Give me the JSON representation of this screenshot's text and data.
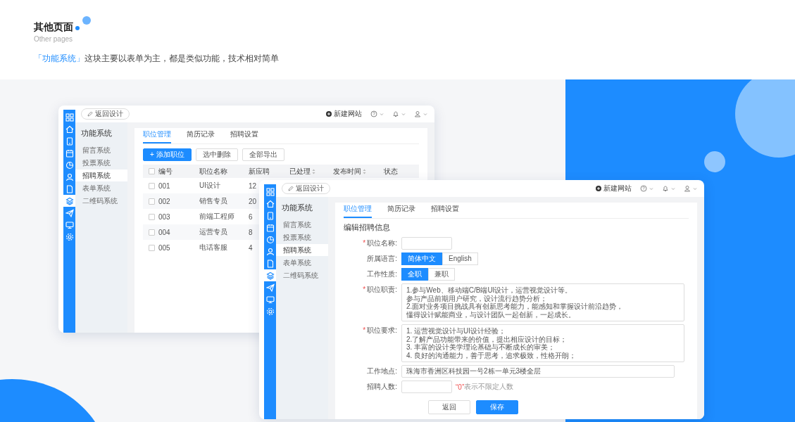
{
  "header": {
    "title": "其他页面",
    "subtitle": "Other pages",
    "description_highlight": "「功能系统」",
    "description": "这块主要以表单为主，都是类似功能，技术相对简单"
  },
  "windows": [
    {
      "kind": "list",
      "back_button": "返回设计",
      "new_site": "新建网站",
      "icon_bar": [
        {
          "selected": false
        },
        {
          "selected": false
        },
        {
          "selected": false
        },
        {
          "selected": false
        },
        {
          "selected": false
        },
        {
          "selected": false
        },
        {
          "selected": false
        },
        {
          "selected": true
        },
        {
          "selected": false
        },
        {
          "selected": false
        },
        {
          "selected": false
        }
      ],
      "nav": {
        "title": "功能系统",
        "items": [
          {
            "label": "留言系统",
            "selected": false
          },
          {
            "label": "投票系统",
            "selected": false
          },
          {
            "label": "招聘系统",
            "selected": true
          },
          {
            "label": "表单系统",
            "selected": false
          },
          {
            "label": "二维码系统",
            "selected": false
          }
        ]
      },
      "tabs": [
        {
          "label": "职位管理",
          "selected": true
        },
        {
          "label": "简历记录",
          "selected": false
        },
        {
          "label": "招聘设置",
          "selected": false
        }
      ],
      "toolbar": [
        {
          "label": "+ 添加职位",
          "primary": true
        },
        {
          "label": "选中删除",
          "primary": false
        },
        {
          "label": "全部导出",
          "primary": false
        }
      ],
      "table": {
        "header_checked": false,
        "columns": [
          {
            "label": "编号",
            "kind": "plain"
          },
          {
            "label": "职位名称",
            "kind": "plain"
          },
          {
            "label": "新应聘",
            "kind": "plain"
          },
          {
            "label": "已处理",
            "kind": "sortable"
          },
          {
            "label": "发布时间",
            "kind": "sortable"
          },
          {
            "label": "状态",
            "kind": "plain"
          }
        ],
        "rows": [
          {
            "checked": false,
            "cells": [
              "001",
              "UI设计",
              "12"
            ]
          },
          {
            "checked": false,
            "cells": [
              "002",
              "销售专员",
              "20"
            ]
          },
          {
            "checked": false,
            "cells": [
              "003",
              "前端工程师",
              "6"
            ]
          },
          {
            "checked": false,
            "cells": [
              "004",
              "运营专员",
              "8"
            ]
          },
          {
            "checked": false,
            "cells": [
              "005",
              "电话客服",
              "4"
            ]
          }
        ]
      }
    },
    {
      "kind": "form",
      "back_button": "返回设计",
      "new_site": "新建网站",
      "icon_bar": [
        {
          "selected": false
        },
        {
          "selected": false
        },
        {
          "selected": false
        },
        {
          "selected": false
        },
        {
          "selected": false
        },
        {
          "selected": false
        },
        {
          "selected": false
        },
        {
          "selected": true
        },
        {
          "selected": false
        },
        {
          "selected": false
        },
        {
          "selected": false
        }
      ],
      "nav": {
        "title": "功能系统",
        "items": [
          {
            "label": "留言系统",
            "selected": false
          },
          {
            "label": "投票系统",
            "selected": false
          },
          {
            "label": "招聘系统",
            "selected": true
          },
          {
            "label": "表单系统",
            "selected": false
          },
          {
            "label": "二维码系统",
            "selected": false
          }
        ]
      },
      "tabs": [
        {
          "label": "职位管理",
          "selected": true
        },
        {
          "label": "简历记录",
          "selected": false
        },
        {
          "label": "招聘设置",
          "selected": false
        }
      ],
      "form": {
        "title": "编辑招聘信息",
        "fields": [
          {
            "kind": "input",
            "required_mark": "*",
            "label": "职位名称:"
          },
          {
            "kind": "choice",
            "label": "所属语言:",
            "options": [
              {
                "label": "简体中文",
                "selected": true
              },
              {
                "label": "English",
                "selected": false
              }
            ]
          },
          {
            "kind": "choice",
            "label": "工作性质:",
            "options": [
              {
                "label": "全职",
                "selected": true
              },
              {
                "label": "兼职",
                "selected": false
              }
            ]
          },
          {
            "kind": "textarea",
            "required_mark": "*",
            "label": "职位职责:",
            "lines": [
              "1.参与Web、移动端C/B端UI设计，运营视觉设计等。",
              "参与产品前期用户研究，设计流行趋势分析；",
              "2.面对业务项目挑战具有创新思考能力，能感知和掌握设计前沿趋势，",
              "懂得设计赋能商业，与设计团队一起创新，一起成长。"
            ]
          },
          {
            "kind": "textarea",
            "required_mark": "*",
            "label": "职位要求:",
            "lines": [
              "1. 运营视觉设计与UI设计经验；",
              "2.了解产品功能带来的价值，提出相应设计的目标；",
              "3. 丰富的设计美学理论基础与不断成长的审美；",
              "4. 良好的沟通能力，善于思考，追求极致，性格开朗；"
            ]
          },
          {
            "kind": "wide-input",
            "label": "工作地点:",
            "value": "珠海市香洲区科技园一号2栋一单元3楼全层"
          },
          {
            "kind": "input",
            "label": "招聘人数:",
            "hint_mark": "“0”",
            "hint": "表示不限定人数"
          }
        ],
        "buttons": [
          {
            "label": "返回",
            "primary": false
          },
          {
            "label": "保存",
            "primary": true
          }
        ]
      }
    }
  ]
}
